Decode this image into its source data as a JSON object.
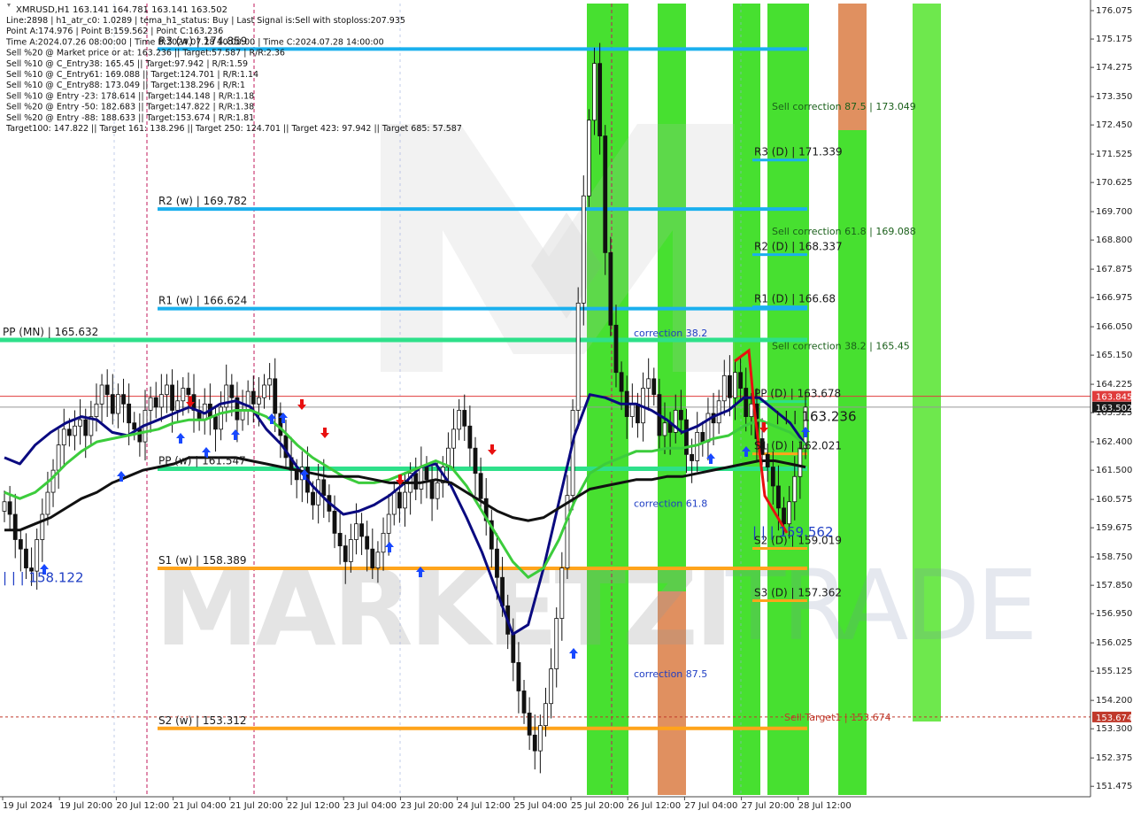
{
  "chart_data": {
    "type": "candlestick",
    "symbol_header": "XMRUSD,H1  163.141 164.781 163.141 163.502",
    "info_lines": [
      "Line:2898 | h1_atr_c0: 1.0289 | tema_h1_status: Buy | Last Signal is:Sell with stoploss:207.935",
      "Point A:174.976 | Point B:159.562 | Point C:163.236",
      "Time A:2024.07.26 08:00:00 | Time B:2024.07.28 10:00:00 | Time C:2024.07.28 14:00:00",
      "Sell %20 @ Market price or at: 163.236 || Target:57.587 | R/R:2.36",
      "Sell %10 @ C_Entry38: 165.45 || Target:97.942 | R/R:1.59",
      "Sell %10 @ C_Entry61: 169.088 || Target:124.701 | R/R:1.14",
      "Sell %10 @ C_Entry88: 173.049 || Target:138.296 | R/R:1",
      "Sell %10 @ Entry -23: 178.614 || Target:144.148 | R/R:1.18",
      "Sell %20 @ Entry -50: 182.683 || Target:147.822 | R/R:1.38",
      "Sell %20 @ Entry -88: 188.633 || Target:153.674 | R/R:1.81",
      "Target100: 147.822 || Target 161: 138.296 || Target 250: 124.701 || Target 423: 97.942 || Target 685: 57.587"
    ],
    "y_ticks": [
      "176.075",
      "175.175",
      "174.275",
      "173.350",
      "172.450",
      "171.525",
      "170.625",
      "169.700",
      "168.800",
      "167.875",
      "166.975",
      "166.050",
      "165.150",
      "164.225",
      "163.325",
      "162.400",
      "161.500",
      "160.575",
      "159.675",
      "158.750",
      "157.850",
      "156.950",
      "156.025",
      "155.125",
      "154.200",
      "153.300",
      "152.375",
      "151.475"
    ],
    "x_ticks": [
      "19 Jul 2024",
      "19 Jul 20:00",
      "20 Jul 12:00",
      "21 Jul 04:00",
      "21 Jul 20:00",
      "22 Jul 12:00",
      "23 Jul 04:00",
      "23 Jul 20:00",
      "24 Jul 12:00",
      "25 Jul 04:00",
      "25 Jul 20:00",
      "26 Jul 12:00",
      "27 Jul 04:00",
      "27 Jul 20:00",
      "28 Jul 12:00"
    ],
    "y_range": [
      151.2,
      176.3
    ],
    "price_tags": [
      {
        "text": "163.845",
        "value": 163.845,
        "color": "#e03c3c"
      },
      {
        "text": "163.502",
        "value": 163.502,
        "color": "#1a1a1a"
      },
      {
        "text": "153.674",
        "value": 153.674,
        "color": "#c0392b"
      }
    ],
    "weekly_levels": [
      {
        "text": "R3 (w) | 174.859",
        "value": 174.859
      },
      {
        "text": "R2 (w) | 169.782",
        "value": 169.782
      },
      {
        "text": "R1 (w) | 166.624",
        "value": 166.624
      },
      {
        "text": "PP (w) | 161.547",
        "value": 161.547
      },
      {
        "text": "S1 (w) | 158.389",
        "value": 158.389
      },
      {
        "text": "S2 (w) | 153.312",
        "value": 153.312
      }
    ],
    "monthly_level": {
      "text": "PP (MN) | 165.632",
      "value": 165.632
    },
    "daily_levels": [
      {
        "text": "R3 (D) | 171.339",
        "value": 171.339
      },
      {
        "text": "R2 (D) | 168.337",
        "value": 168.337
      },
      {
        "text": "R1 (D) | 166.68",
        "value": 166.68
      },
      {
        "text": "PP (D) | 163.678",
        "value": 163.678
      },
      {
        "text": "S1 (D) | 162.021",
        "value": 162.021
      },
      {
        "text": "S2 (D) | 159.019",
        "value": 159.019
      },
      {
        "text": "S3 (D) | 157.362",
        "value": 157.362
      }
    ],
    "corrections": [
      {
        "text": "correction 38.2",
        "value": 165.85
      },
      {
        "text": "correction 61.8",
        "value": 160.45
      },
      {
        "text": "correction 87.5",
        "value": 155.05
      }
    ],
    "sell_corrections": [
      {
        "text": "Sell correction 87.5 | 173.049",
        "value": 173.049
      },
      {
        "text": "Sell correction 61.8 | 169.088",
        "value": 169.088
      },
      {
        "text": "Sell correction 38.2 | 165.45",
        "value": 165.45
      },
      {
        "text": "Sell Target1 | 153.674",
        "value": 153.674
      }
    ],
    "point_labels": [
      {
        "text": "| | | 163.236",
        "value": 163.236
      },
      {
        "text": "| | | 159.562",
        "value": 159.562
      },
      {
        "text": "| | | 158.122",
        "value": 158.122
      }
    ],
    "series": [
      {
        "color": "#0a0a80",
        "values": [
          161.9,
          161.7,
          162.3,
          162.7,
          163.0,
          163.2,
          163.1,
          162.7,
          162.6,
          162.9,
          163.1,
          163.3,
          163.5,
          163.3,
          163.6,
          163.7,
          163.5,
          162.8,
          162.3,
          161.6,
          161.0,
          160.5,
          160.1,
          160.2,
          160.4,
          160.7,
          161.1,
          161.6,
          161.7,
          161.0,
          160.0,
          158.9,
          157.6,
          156.3,
          156.6,
          158.4,
          160.5,
          162.6,
          163.9,
          163.8,
          163.6,
          163.6,
          163.4,
          163.1,
          162.7,
          162.9,
          163.2,
          163.4,
          163.8,
          163.8,
          163.4,
          163.0,
          162.3
        ]
      },
      {
        "color": "#3ccc3c",
        "values": [
          160.8,
          160.6,
          160.8,
          161.2,
          161.7,
          162.1,
          162.4,
          162.5,
          162.6,
          162.7,
          162.8,
          163.0,
          163.1,
          163.1,
          163.3,
          163.4,
          163.4,
          163.2,
          162.8,
          162.3,
          161.9,
          161.6,
          161.3,
          161.1,
          161.1,
          161.2,
          161.4,
          161.6,
          161.8,
          161.6,
          161.0,
          160.2,
          159.4,
          158.6,
          158.1,
          158.4,
          159.3,
          160.5,
          161.4,
          161.7,
          161.9,
          162.1,
          162.1,
          162.2,
          162.2,
          162.3,
          162.5,
          162.6,
          162.9,
          163.1,
          162.9,
          162.7,
          162.3
        ]
      },
      {
        "color": "#111111",
        "values": [
          159.6,
          159.6,
          159.8,
          160.0,
          160.3,
          160.6,
          160.8,
          161.1,
          161.3,
          161.5,
          161.6,
          161.7,
          161.9,
          161.9,
          161.9,
          161.9,
          161.8,
          161.7,
          161.6,
          161.5,
          161.4,
          161.3,
          161.3,
          161.3,
          161.2,
          161.1,
          161.1,
          161.1,
          161.2,
          161.1,
          160.8,
          160.5,
          160.2,
          160.0,
          159.9,
          160.0,
          160.3,
          160.6,
          160.9,
          161.0,
          161.1,
          161.2,
          161.2,
          161.3,
          161.3,
          161.4,
          161.5,
          161.6,
          161.7,
          161.8,
          161.8,
          161.7,
          161.6
        ]
      }
    ],
    "candles_close": [
      160.5,
      160.1,
      159.3,
      159.0,
      158.4,
      158.3,
      159.3,
      160.1,
      160.8,
      161.5,
      162.3,
      162.8,
      162.6,
      162.9,
      163.1,
      162.6,
      163.2,
      163.6,
      164.2,
      163.9,
      163.3,
      163.9,
      163.6,
      163.0,
      162.8,
      162.4,
      163.4,
      163.8,
      163.5,
      163.9,
      164.2,
      163.4,
      163.7,
      164.1,
      163.9,
      163.4,
      163.1,
      163.6,
      163.2,
      162.8,
      163.5,
      164.2,
      163.8,
      163.1,
      163.4,
      164.0,
      163.6,
      163.8,
      164.2,
      164.4,
      163.3,
      162.6,
      161.9,
      161.5,
      161.2,
      161.6,
      160.8,
      160.4,
      161.2,
      160.7,
      160.2,
      159.5,
      159.1,
      158.6,
      159.3,
      159.8,
      159.4,
      159.0,
      158.4,
      158.9,
      159.5,
      160.1,
      160.8,
      160.3,
      160.8,
      161.4,
      160.9,
      161.6,
      161.2,
      160.6,
      161.1,
      161.6,
      162.2,
      162.8,
      163.4,
      162.9,
      162.2,
      161.4,
      160.6,
      159.9,
      159.0,
      158.1,
      157.2,
      156.3,
      155.4,
      154.5,
      153.8,
      153.1,
      152.6,
      153.4,
      154.1,
      155.2,
      156.8,
      158.4,
      160.7,
      163.4,
      166.8,
      170.2,
      172.6,
      174.4,
      172.1,
      168.4,
      166.1,
      164.6,
      164.0,
      163.2,
      163.6,
      163.0,
      164.1,
      164.4,
      163.9,
      162.6,
      163.0,
      162.7,
      163.4,
      163.1,
      162.0,
      161.8,
      162.7,
      162.4,
      163.3,
      163.0,
      163.7,
      164.5,
      163.8,
      164.6,
      164.1,
      163.2,
      163.6,
      162.5,
      162.0,
      161.6,
      161.0,
      160.3,
      159.8,
      160.5,
      161.3,
      162.2,
      163.5
    ]
  }
}
